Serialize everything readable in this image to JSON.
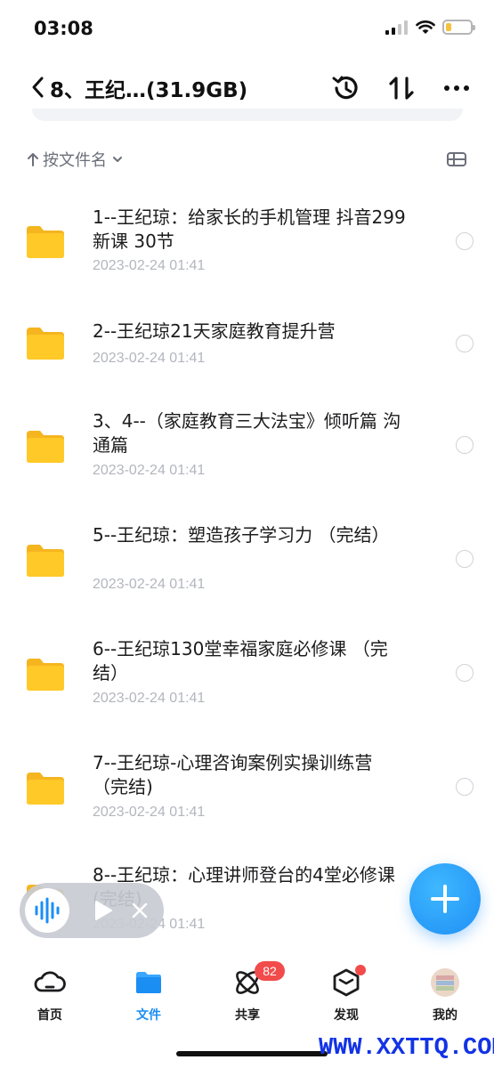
{
  "status_bar": {
    "time": "03:08"
  },
  "header": {
    "title": "8、王纪…(31.9GB)"
  },
  "sort": {
    "label": "按文件名"
  },
  "files": [
    {
      "name": "1--王纪琼：给家长的手机管理 抖音299新课 30节",
      "date": "2023-02-24 01:41"
    },
    {
      "name": "2--王纪琼21天家庭教育提升营",
      "date": "2023-02-24 01:41"
    },
    {
      "name": "3、4--（家庭教育三大法宝》倾听篇 沟通篇",
      "date": "2023-02-24 01:41"
    },
    {
      "name": "5--王纪琼：塑造孩子学习力 （完结）",
      "date": "2023-02-24 01:41"
    },
    {
      "name": "6--王纪琼130堂幸福家庭必修课 （完结）",
      "date": "2023-02-24 01:41"
    },
    {
      "name": "7--王纪琼-心理咨询案例实操训练营 （完结)",
      "date": "2023-02-24 01:41"
    },
    {
      "name": "8--王纪琼：心理讲师登台的4堂必修课 (完结)",
      "date": "2023-02-24 01:41"
    }
  ],
  "tabs": [
    {
      "label": "首页",
      "icon": "cloud-icon"
    },
    {
      "label": "文件",
      "icon": "folder-icon",
      "active": true
    },
    {
      "label": "共享",
      "icon": "atom-icon",
      "badge": "82"
    },
    {
      "label": "发现",
      "icon": "cube-icon",
      "dot": true
    },
    {
      "label": "我的",
      "icon": "avatar"
    }
  ],
  "watermark": "WWW.XXTTQ.COM",
  "colors": {
    "accent": "#1b8ef4",
    "folder": "#ffc928",
    "badge": "#f24b4b",
    "watermark": "#1233e6"
  }
}
